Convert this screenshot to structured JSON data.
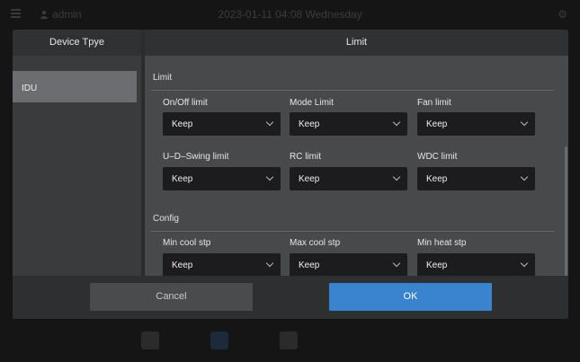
{
  "topbar": {
    "user": "admin",
    "datetime": "2023-01-11 04:08 Wednesday"
  },
  "dialog": {
    "left_header": "Device Tpye",
    "device_types": [
      "IDU"
    ],
    "right_header": "Limit",
    "limit_section": {
      "title": "Limit",
      "fields": [
        {
          "label": "On/Off limit",
          "value": "Keep"
        },
        {
          "label": "Mode Limit",
          "value": "Keep"
        },
        {
          "label": "Fan limit",
          "value": "Keep"
        },
        {
          "label": "U–D–Swing limit",
          "value": "Keep"
        },
        {
          "label": "RC limit",
          "value": "Keep"
        },
        {
          "label": "WDC limit",
          "value": "Keep"
        }
      ]
    },
    "config_section": {
      "title": "Config",
      "fields": [
        {
          "label": "Min cool stp",
          "value": "Keep"
        },
        {
          "label": "Max cool stp",
          "value": "Keep"
        },
        {
          "label": "Min heat stp",
          "value": "Keep"
        }
      ]
    },
    "buttons": {
      "cancel": "Cancel",
      "ok": "OK"
    }
  },
  "colors": {
    "accent": "#3a84cf",
    "dialog_bg": "#3a3b3d",
    "select_bg": "#1c1c1e"
  }
}
